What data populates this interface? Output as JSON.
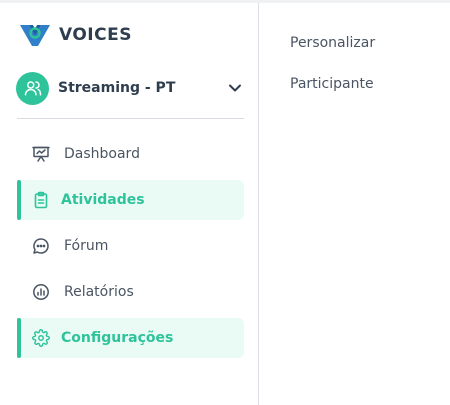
{
  "brand": {
    "name": "VOICES",
    "color": "#2f3e4e",
    "accent": "#2ec39a"
  },
  "workspace": {
    "name": "Streaming - PT",
    "icon": "users-icon",
    "chevron": "chevron-down-icon"
  },
  "nav": {
    "items": [
      {
        "label": "Dashboard",
        "icon": "presentation-icon",
        "active": false
      },
      {
        "label": "Atividades",
        "icon": "clipboard-icon",
        "active": true
      },
      {
        "label": "Fórum",
        "icon": "chat-bubble-icon",
        "active": false
      },
      {
        "label": "Relatórios",
        "icon": "chart-circle-icon",
        "active": false
      },
      {
        "label": "Configurações",
        "icon": "gear-icon",
        "active": true
      }
    ]
  },
  "submenu": {
    "items": [
      {
        "label": "Personalizar"
      },
      {
        "label": "Participante"
      }
    ]
  }
}
